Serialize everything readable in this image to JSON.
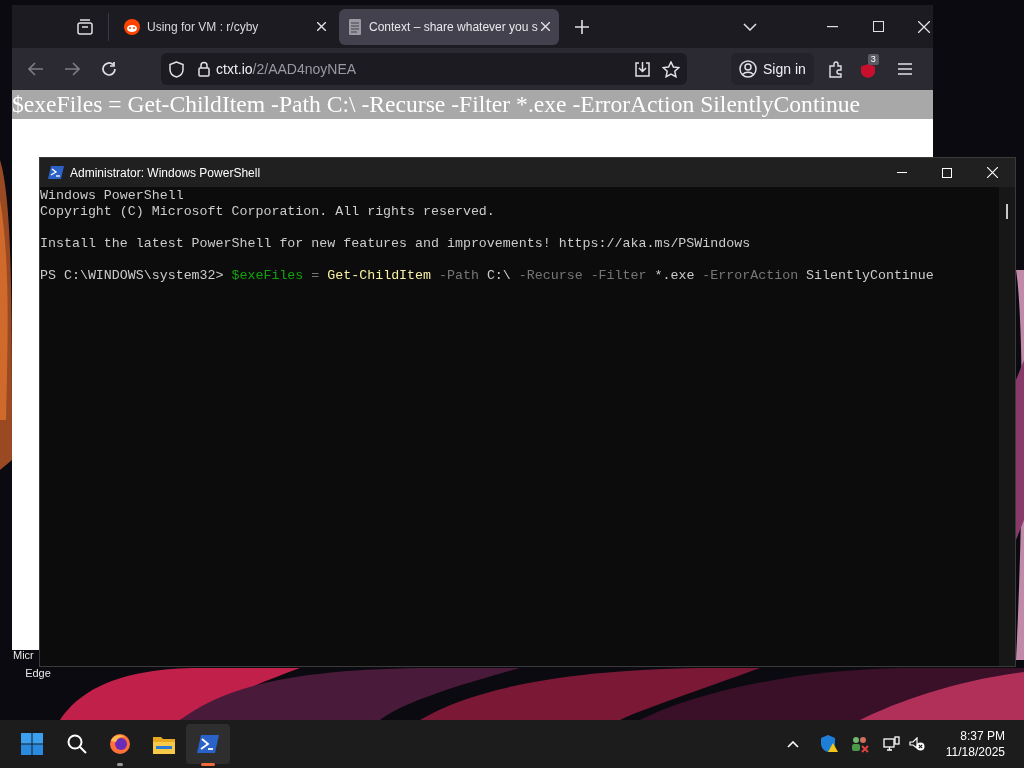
{
  "browser": {
    "tabs": [
      {
        "title": "Using for VM : r/cyby",
        "kind": "reddit",
        "selected": false
      },
      {
        "title": "Context – share whatever you s",
        "kind": "document",
        "selected": true
      }
    ],
    "url": {
      "host": "ctxt.io",
      "path": "/2/AAD4noyNEA"
    },
    "sign_in": "Sign in",
    "extension_badge": "3",
    "page_text": "$exeFiles = Get-ChildItem -Path C:\\ -Recurse -Filter *.exe -ErrorAction SilentlyContinue"
  },
  "powershell": {
    "title": "Administrator: Windows PowerShell",
    "paragraphs": [
      {
        "lines": [
          [
            {
              "text": "Windows PowerShell",
              "kind": "plain"
            }
          ],
          [
            {
              "text": "Copyright (C) Microsoft Corporation. All rights reserved.",
              "kind": "plain"
            }
          ]
        ]
      },
      {
        "lines": [
          [
            {
              "text": "Install the latest PowerShell for new features and improvements! https://aka.ms/PSWindows",
              "kind": "plain"
            }
          ]
        ]
      },
      {
        "lines": [
          [
            {
              "text": "PS C:\\WINDOWS\\system32> ",
              "kind": "plain"
            },
            {
              "text": "$exeFiles",
              "kind": "variable"
            },
            {
              "text": " = ",
              "kind": "operator"
            },
            {
              "text": "Get-ChildItem",
              "kind": "command"
            },
            {
              "text": " -Path ",
              "kind": "parameter"
            },
            {
              "text": "C:\\",
              "kind": "plain"
            },
            {
              "text": " -Recurse -Filter ",
              "kind": "parameter"
            },
            {
              "text": "*.exe",
              "kind": "plain"
            },
            {
              "text": " -ErrorAction ",
              "kind": "parameter"
            },
            {
              "text": "SilentlyContinue",
              "kind": "plain"
            }
          ]
        ]
      }
    ]
  },
  "desktop_icon": {
    "label_lines": [
      "Micr",
      "Edge"
    ]
  },
  "taskbar": {
    "apps": [
      {
        "kind": "firefox",
        "running": true,
        "selected": false
      },
      {
        "kind": "explorer",
        "running": false,
        "selected": false
      },
      {
        "kind": "powershell",
        "running": true,
        "selected": true
      }
    ],
    "clock": {
      "time": "8:37 PM",
      "date": "11/18/2025"
    }
  }
}
